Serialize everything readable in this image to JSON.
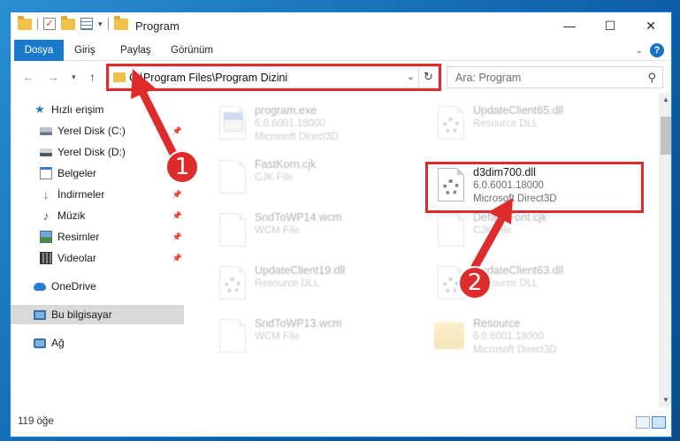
{
  "window": {
    "title": "Program",
    "controls": {
      "minimize": "—",
      "maximize": "☐",
      "close": "✕"
    }
  },
  "ribbon": {
    "tabs": [
      "Dosya",
      "Giriş",
      "Paylaş",
      "Görünüm"
    ]
  },
  "address": {
    "path": "C:\\Program Files\\Program Dizini",
    "search_placeholder": "Ara: Program"
  },
  "sidebar": {
    "items": [
      {
        "label": "Hızlı erişim",
        "icon": "star-icon"
      },
      {
        "label": "Yerel Disk (C:)",
        "icon": "disk-icon",
        "pinned": true
      },
      {
        "label": "Yerel Disk (D:)",
        "icon": "disk-icon"
      },
      {
        "label": "Belgeler",
        "icon": "documents-icon"
      },
      {
        "label": "İndirmeler",
        "icon": "download-icon",
        "pinned": true
      },
      {
        "label": "Müzik",
        "icon": "music-icon",
        "pinned": true
      },
      {
        "label": "Resimler",
        "icon": "pictures-icon",
        "pinned": true
      },
      {
        "label": "Videolar",
        "icon": "videos-icon",
        "pinned": true
      },
      {
        "label": "OneDrive",
        "icon": "cloud-icon"
      },
      {
        "label": "Bu bilgisayar",
        "icon": "computer-icon",
        "selected": true
      },
      {
        "label": "Ağ",
        "icon": "network-icon"
      }
    ]
  },
  "files": [
    {
      "name": "program.exe",
      "line1": "6.0.6001.18000",
      "line2": "Microsoft Direct3D",
      "icon": "exe-icon",
      "faded": true
    },
    {
      "name": "UpdateClient65.dll",
      "line1": "Resource DLL",
      "line2": "",
      "icon": "dll-icon",
      "faded": true
    },
    {
      "name": "FastKorn.cjk",
      "line1": "CJK File",
      "line2": "",
      "icon": "file-icon",
      "faded": true
    },
    {
      "name": "d3dim700.dll",
      "line1": "6.0.6001.18000",
      "line2": "Microsoft Direct3D",
      "icon": "dll-icon",
      "faded": false
    },
    {
      "name": "SndToWP14.wcm",
      "line1": "WCM File",
      "line2": "",
      "icon": "file-icon",
      "faded": true
    },
    {
      "name": "DefaultFont.cjk",
      "line1": "CJK File",
      "line2": "",
      "icon": "file-icon",
      "faded": true
    },
    {
      "name": "UpdateClient19.dll",
      "line1": "Resource DLL",
      "line2": "",
      "icon": "dll-icon",
      "faded": true
    },
    {
      "name": "UpdateClient63.dll",
      "line1": "Resource DLL",
      "line2": "",
      "icon": "dll-icon",
      "faded": true
    },
    {
      "name": "SndToWP13.wcm",
      "line1": "WCM File",
      "line2": "",
      "icon": "file-icon",
      "faded": true
    },
    {
      "name": "Resource",
      "line1": "6.0.6001.18000",
      "line2": "Microsoft Direct3D",
      "icon": "folder-icon",
      "faded": true
    }
  ],
  "status": {
    "count": "119 öğe"
  },
  "annotations": {
    "step1": "1",
    "step2": "2",
    "color": "#de2b2b"
  }
}
